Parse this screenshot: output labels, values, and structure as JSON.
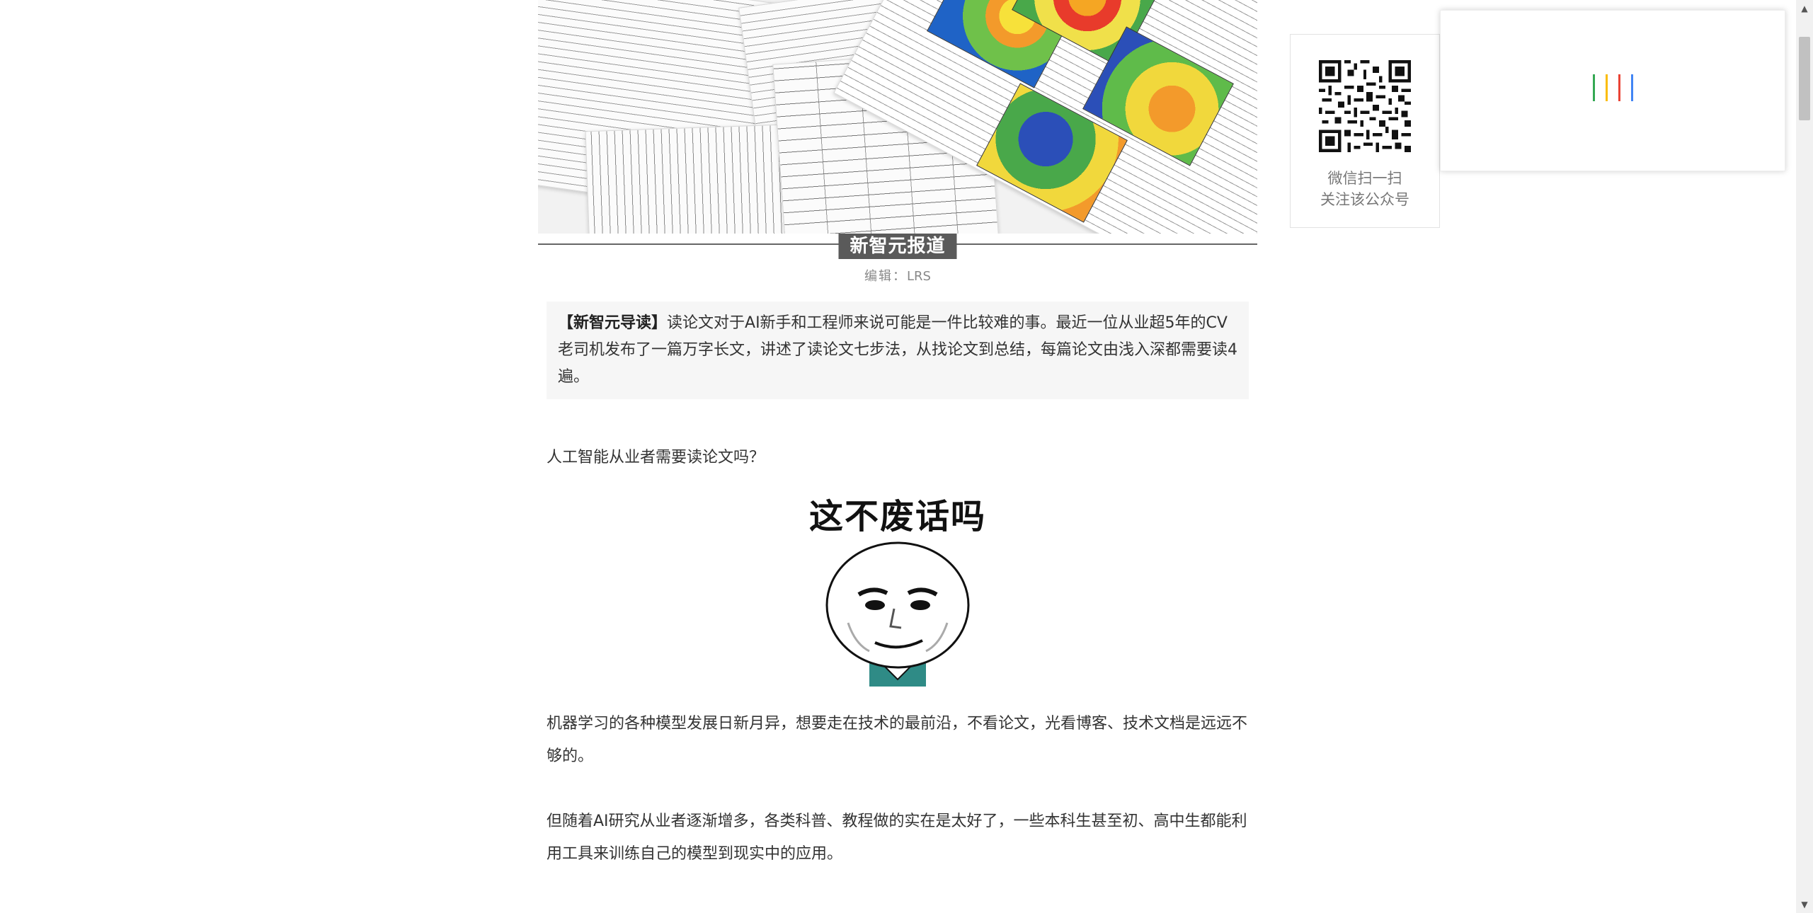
{
  "article": {
    "source_tag": "新智元报道",
    "editor_label": "编辑：",
    "editor_name": "LRS",
    "lead_title": "【新智元导读】",
    "lead_text": "读论文对于AI新手和工程师来说可能是一件比较难的事。最近一位从业超5年的CV老司机发布了一篇万字长文，讲述了读论文七步法，从找论文到总结，每篇论文由浅入深都需要读4遍。",
    "question": "人工智能从业者需要读论文吗？",
    "meme_caption": "这不废话吗",
    "para_ml": "机器学习的各种模型发展日新月异，想要走在技术的最前沿，不看论文，光看博客、技术文档是远远不够的。",
    "para_ai": "但随着AI研究从业者逐渐增多，各类科普、教程做的实在是太好了，一些本科生甚至初、高中生都能利用工具来训练自己的模型到现实中的应用。"
  },
  "qr": {
    "line1": "微信扫一扫",
    "line2": "关注该公众号"
  },
  "loader": {
    "colors": [
      "#34a853",
      "#fbbc05",
      "#ea4335",
      "#4285f4"
    ]
  },
  "colors": {
    "source_tag_bg": "#5a5a5a",
    "lead_bg": "#f6f6f6",
    "text": "#333333",
    "muted": "#888888"
  }
}
